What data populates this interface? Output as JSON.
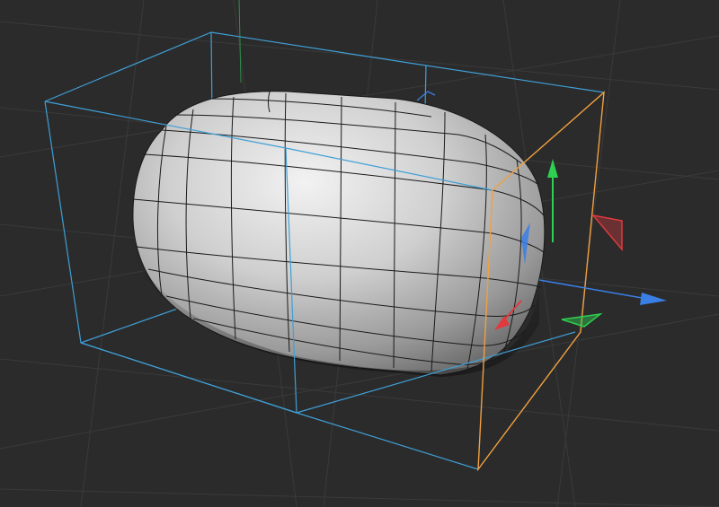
{
  "viewport": {
    "mode": "perspective",
    "display": "gouraud-shading-lines",
    "object": {
      "type": "capsule-like-cube",
      "selected": true,
      "mesh_color": "#bfbfbf",
      "wire_color": "#1a1a1a"
    },
    "colors": {
      "background": "#2b2b2b",
      "grid": "#3a3a3a",
      "bbox": "#3f9fd6",
      "active_face": "#f0a040",
      "axis_x": "#e0393e",
      "axis_y": "#2fcf52",
      "axis_z": "#3a7fe6"
    },
    "gizmo": {
      "kind": "scale-handles",
      "axes": [
        "x-axis",
        "y-axis",
        "z-axis"
      ]
    }
  }
}
